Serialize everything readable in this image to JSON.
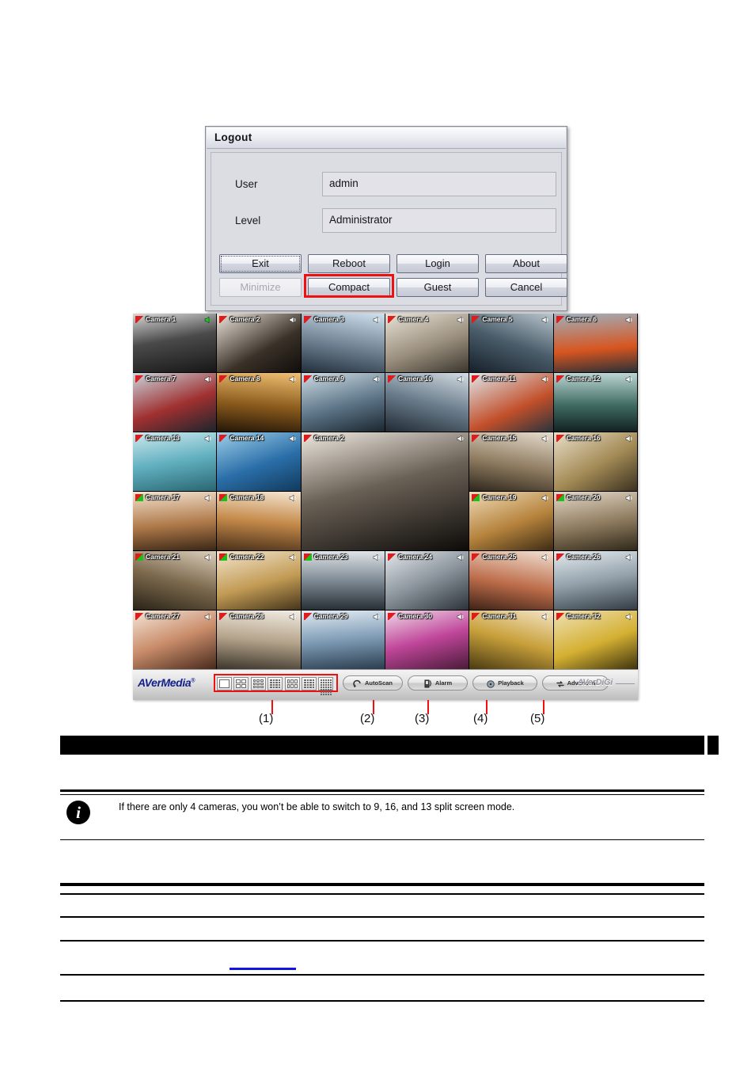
{
  "dialog": {
    "title": "Logout",
    "fields": [
      {
        "label": "User",
        "value": "admin"
      },
      {
        "label": "Level",
        "value": "Administrator"
      }
    ],
    "buttons": [
      {
        "label": "Exit",
        "state": "focused"
      },
      {
        "label": "Reboot",
        "state": "normal"
      },
      {
        "label": "Login",
        "state": "normal"
      },
      {
        "label": "About",
        "state": "normal"
      },
      {
        "label": "Minimize",
        "state": "disabled"
      },
      {
        "label": "Compact",
        "state": "highlighted"
      },
      {
        "label": "Guest",
        "state": "normal"
      },
      {
        "label": "Cancel",
        "state": "normal"
      }
    ],
    "highlight_color": "#ee1111"
  },
  "dvr": {
    "brand_left": "AVerMedia",
    "brand_left_mark": "®",
    "brand_right": "AVerDiGi",
    "split_modes": [
      {
        "name": "split-1",
        "cells": 1,
        "cols": 1
      },
      {
        "name": "split-4",
        "cells": 4,
        "cols": 2
      },
      {
        "name": "split-9",
        "cells": 9,
        "cols": 3
      },
      {
        "name": "split-16",
        "cells": 16,
        "cols": 4
      },
      {
        "name": "split-6",
        "cells": 6,
        "cols": 3
      },
      {
        "name": "split-13",
        "cells": 13,
        "cols": 4
      },
      {
        "name": "split-32",
        "cells": 32,
        "cols": 5
      }
    ],
    "toolbar_buttons": [
      {
        "label": "AutoScan",
        "icon": "autoscan-icon"
      },
      {
        "label": "Alarm",
        "icon": "alarm-icon"
      },
      {
        "label": "Playback",
        "icon": "playback-icon"
      },
      {
        "label": "Advanced",
        "icon": "advanced-icon"
      }
    ],
    "cameras": [
      {
        "name": "Camera 1",
        "audio": "on"
      },
      {
        "name": "Camera 2",
        "audio": "off"
      },
      {
        "name": "Camera 3",
        "audio": "off"
      },
      {
        "name": "Camera 4",
        "audio": "off"
      },
      {
        "name": "Camera 5",
        "audio": "off"
      },
      {
        "name": "Camera 6",
        "audio": "off"
      },
      {
        "name": "Camera 7",
        "audio": "off"
      },
      {
        "name": "Camera 8",
        "audio": "off"
      },
      {
        "name": "Camera 9",
        "audio": "off"
      },
      {
        "name": "Camera 10",
        "audio": "off"
      },
      {
        "name": "Camera 11",
        "audio": "off"
      },
      {
        "name": "Camera 12",
        "audio": "off"
      },
      {
        "name": "Camera 13",
        "audio": "off"
      },
      {
        "name": "Camera 14",
        "audio": "off"
      },
      {
        "name": "Camera 2",
        "audio": "off"
      },
      {
        "name": "Camera 15",
        "audio": "off"
      },
      {
        "name": "Camera 16",
        "audio": "off"
      },
      {
        "name": "Camera 17",
        "audio": "off"
      },
      {
        "name": "Camera 18",
        "audio": "off"
      },
      {
        "name": "Camera 19",
        "audio": "off"
      },
      {
        "name": "Camera 20",
        "audio": "off"
      },
      {
        "name": "Camera 21",
        "audio": "off"
      },
      {
        "name": "Camera 22",
        "audio": "off"
      },
      {
        "name": "Camera 23",
        "audio": "off"
      },
      {
        "name": "Camera 24",
        "audio": "off"
      },
      {
        "name": "Camera 25",
        "audio": "off"
      },
      {
        "name": "Camera 26",
        "audio": "off"
      },
      {
        "name": "Camera 27",
        "audio": "off"
      },
      {
        "name": "Camera 28",
        "audio": "off"
      },
      {
        "name": "Camera 29",
        "audio": "off"
      },
      {
        "name": "Camera 30",
        "audio": "off"
      },
      {
        "name": "Camera 31",
        "audio": "off"
      },
      {
        "name": "Camera 32",
        "audio": "off"
      }
    ]
  },
  "callouts": [
    {
      "label": "(1)"
    },
    {
      "label": "(2)"
    },
    {
      "label": "(3)"
    },
    {
      "label": "(4)"
    },
    {
      "label": "(5)"
    }
  ],
  "note": {
    "icon": "info-icon",
    "glyph": "i",
    "text": "If there are only 4 cameras, you won’t be able to switch to 9, 16, and 13 split screen mode."
  }
}
